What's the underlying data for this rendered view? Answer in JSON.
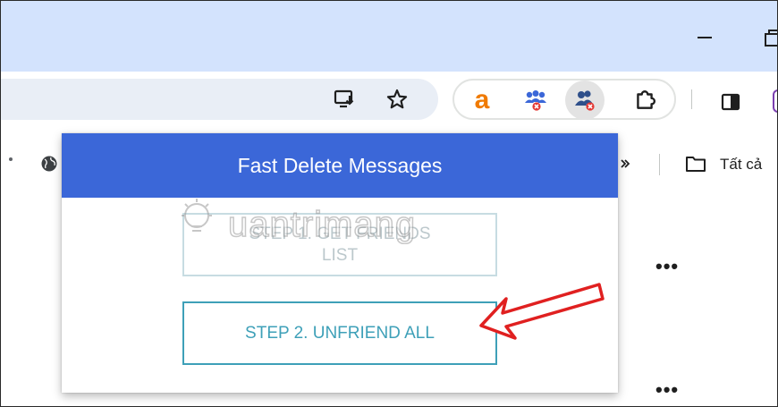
{
  "browser": {
    "window_controls": {
      "minimize": "minimize-icon",
      "restore": "restore-icon"
    },
    "toolbar_icons": [
      "install-app-icon",
      "bookmark-star-icon",
      "amazon-extension-icon",
      "group-remove-extension-icon",
      "unfriend-extension-icon",
      "extensions-puzzle-icon",
      "side-panel-icon"
    ],
    "amazon_letter": "a"
  },
  "bookmarks_bar": {
    "folder_label": "Tất cả"
  },
  "popup": {
    "title": "Fast Delete Messages",
    "step1_line1": "STEP 1. GET FRIENDS",
    "step1_line2": "LIST",
    "step2_label": "STEP 2. UNFRIEND ALL"
  },
  "watermark": "uantrimang",
  "colors": {
    "titlebar": "#d3e3fd",
    "popup_header": "#3b67d8",
    "step2_accent": "#3ea0b8",
    "arrow": "#e02020"
  }
}
